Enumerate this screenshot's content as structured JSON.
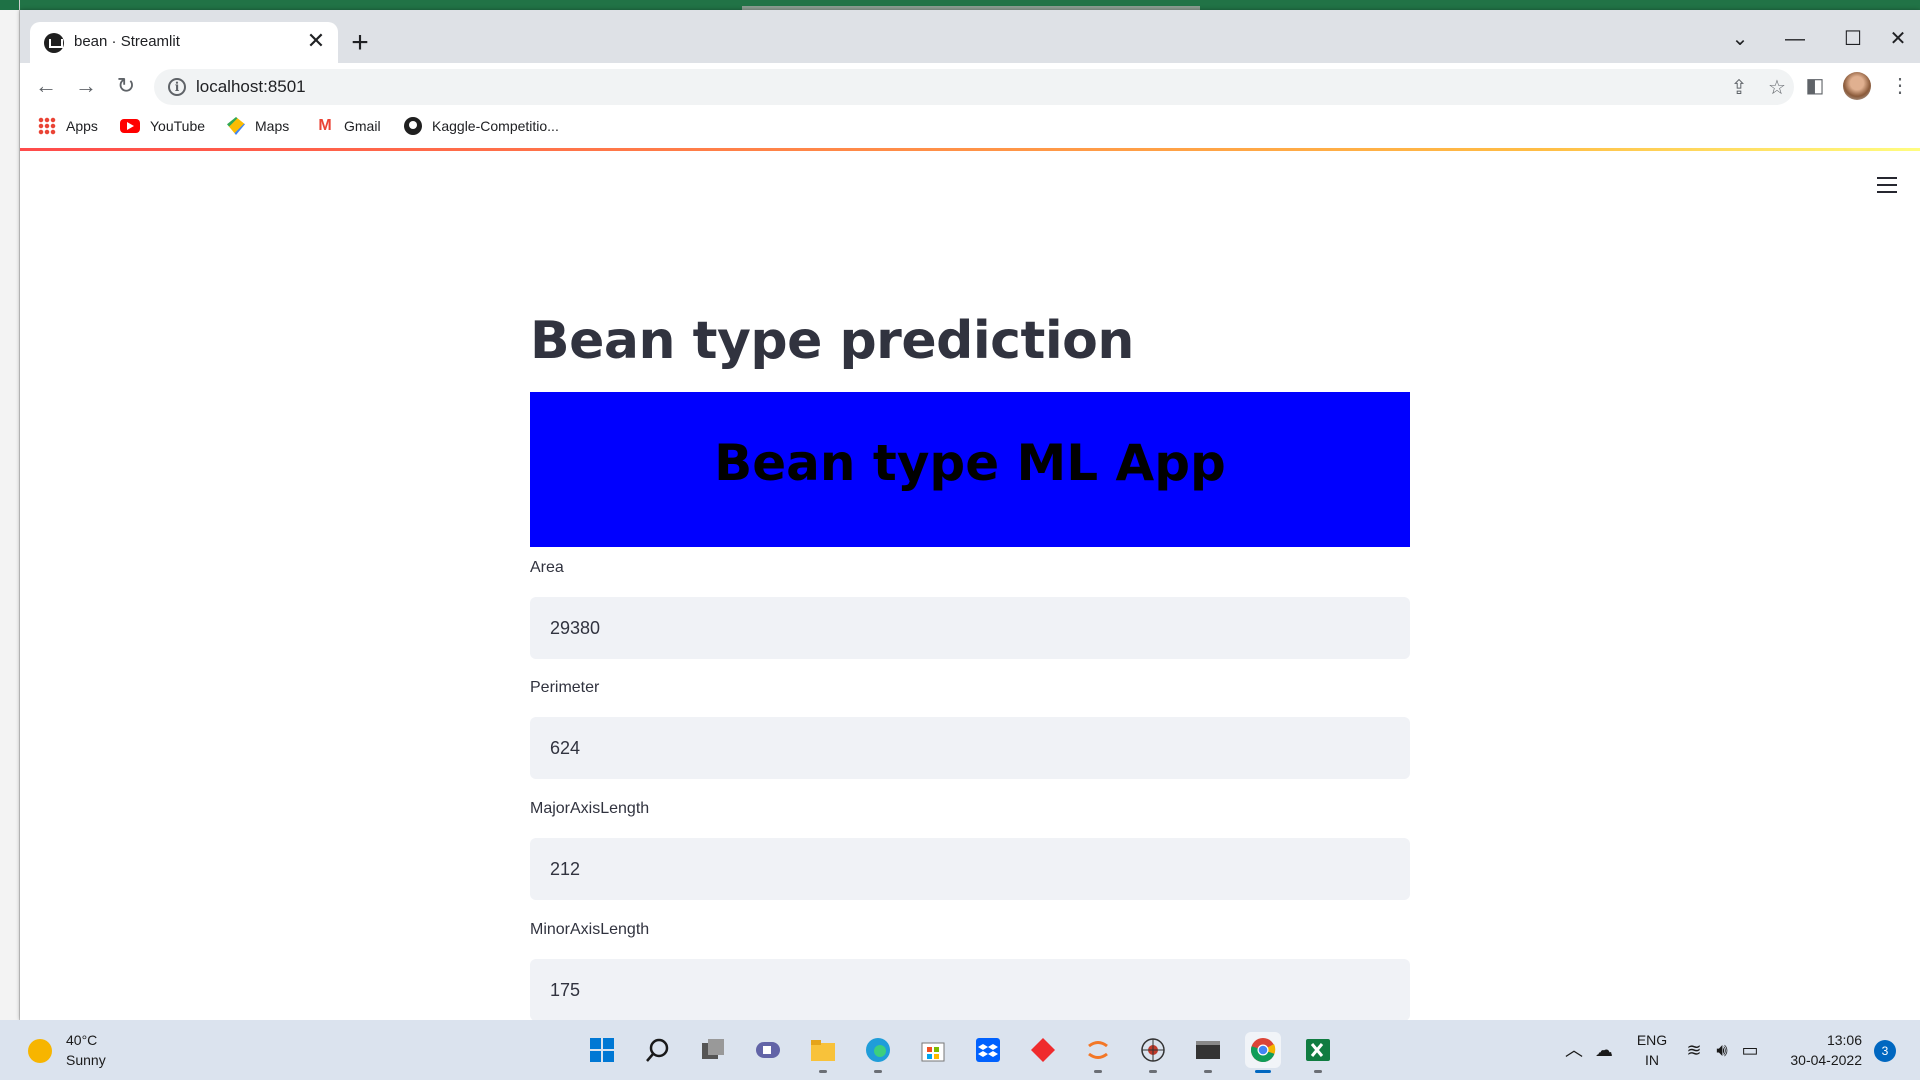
{
  "browser": {
    "tab_title": "bean · Streamlit",
    "url": "localhost:8501",
    "bookmarks": [
      {
        "label": "Apps",
        "icon": "apps-grid-icon"
      },
      {
        "label": "YouTube",
        "icon": "youtube-icon"
      },
      {
        "label": "Maps",
        "icon": "maps-icon"
      },
      {
        "label": "Gmail",
        "icon": "gmail-icon"
      },
      {
        "label": "Kaggle-Competitio...",
        "icon": "github-icon"
      }
    ]
  },
  "app": {
    "title": "Bean type prediction",
    "banner_text": "Bean type ML App",
    "banner_color": "#0000ff",
    "fields": [
      {
        "label": "Area",
        "value": "29380"
      },
      {
        "label": "Perimeter",
        "value": "624"
      },
      {
        "label": "MajorAxisLength",
        "value": "212"
      },
      {
        "label": "MinorAxisLength",
        "value": "175"
      }
    ]
  },
  "taskbar": {
    "weather_temp": "40°C",
    "weather_desc": "Sunny",
    "lang_1": "ENG",
    "lang_2": "IN",
    "time": "13:06",
    "date": "30-04-2022",
    "notification_count": "3"
  }
}
